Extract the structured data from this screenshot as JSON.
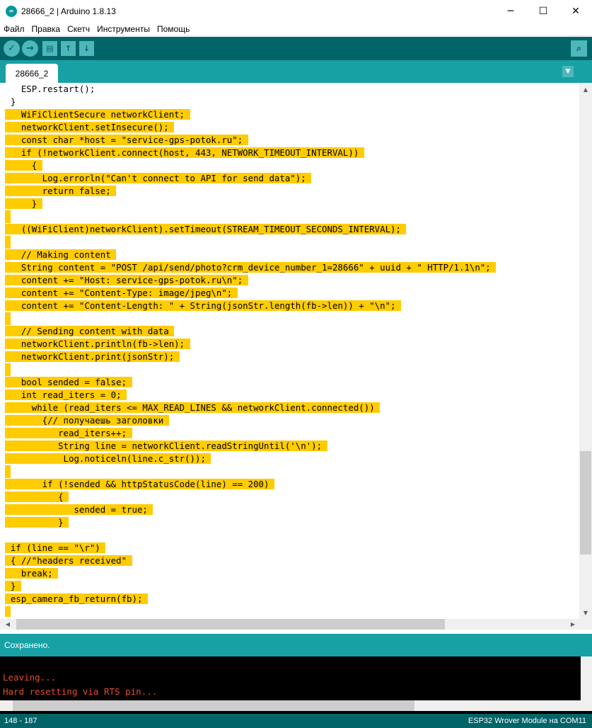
{
  "window": {
    "title": "28666_2 | Arduino 1.8.13",
    "minimize": "─",
    "maximize": "☐",
    "close": "✕"
  },
  "menu": [
    "Файл",
    "Правка",
    "Скетч",
    "Инструменты",
    "Помощь"
  ],
  "toolbar": {
    "verify_icon": "✓",
    "upload_icon": "→",
    "new_icon": "▤",
    "open_icon": "↑",
    "save_icon": "↓",
    "serial_icon": "⌕"
  },
  "tab": {
    "label": "28666_2",
    "menu_icon": "▼"
  },
  "code_lines": [
    {
      "t": "    ESP.restart();",
      "hl": false
    },
    {
      "t": "  }",
      "hl": false
    },
    {
      "t": "    WiFiClientSecure networkClient;",
      "hl": true
    },
    {
      "t": "    networkClient.setInsecure();",
      "hl": true
    },
    {
      "t": "    const char *host = \"service-gps-potok.ru\";",
      "hl": true
    },
    {
      "t": "    if (!networkClient.connect(host, 443, NETWORK_TIMEOUT_INTERVAL))",
      "hl": true
    },
    {
      "t": "      {",
      "hl": true
    },
    {
      "t": "        Log.errorln(\"Can't connect to API for send data\");",
      "hl": true
    },
    {
      "t": "        return false;",
      "hl": true
    },
    {
      "t": "      }",
      "hl": true
    },
    {
      "t": "",
      "hl": true
    },
    {
      "t": "    ((WiFiClient)networkClient).setTimeout(STREAM_TIMEOUT_SECONDS_INTERVAL);",
      "hl": true
    },
    {
      "t": "",
      "hl": true
    },
    {
      "t": "    // Making content",
      "hl": true
    },
    {
      "t": "    String content = \"POST /api/send/photo?crm_device_number_1=28666\" + uuid + \" HTTP/1.1\\n\";",
      "hl": true
    },
    {
      "t": "    content += \"Host: service-gps-potok.ru\\n\";",
      "hl": true
    },
    {
      "t": "    content += \"Content-Type: image/jpeg\\n\";",
      "hl": true
    },
    {
      "t": "    content += \"Content-Length: \" + String(jsonStr.length(fb->len)) + \"\\n\";",
      "hl": true
    },
    {
      "t": "",
      "hl": true
    },
    {
      "t": "    // Sending content with data",
      "hl": true
    },
    {
      "t": "    networkClient.println(fb->len);",
      "hl": true
    },
    {
      "t": "    networkClient.print(jsonStr);",
      "hl": true
    },
    {
      "t": "",
      "hl": true
    },
    {
      "t": "    bool sended = false;",
      "hl": true
    },
    {
      "t": "    int read_iters = 0;",
      "hl": true
    },
    {
      "t": "      while (read_iters <= MAX_READ_LINES && networkClient.connected())",
      "hl": true
    },
    {
      "t": "        {// получаешь заголовки",
      "hl": true
    },
    {
      "t": "           read_iters++;",
      "hl": true
    },
    {
      "t": "           String line = networkClient.readStringUntil('\\n');",
      "hl": true
    },
    {
      "t": "            Log.noticeln(line.c_str());",
      "hl": true
    },
    {
      "t": "",
      "hl": true
    },
    {
      "t": "        if (!sended && httpStatusCode(line) == 200)",
      "hl": true
    },
    {
      "t": "           {",
      "hl": true
    },
    {
      "t": "              sended = true;",
      "hl": true
    },
    {
      "t": "           }",
      "hl": true
    },
    {
      "t": "",
      "hl": false
    },
    {
      "t": "  if (line == \"\\r\")",
      "hl": true
    },
    {
      "t": "  { //\"headers received\"",
      "hl": true
    },
    {
      "t": "    break;",
      "hl": true
    },
    {
      "t": "  }",
      "hl": true
    },
    {
      "t": "  esp_camera_fb_return(fb);",
      "hl": true
    },
    {
      "t": "}",
      "hl": true
    }
  ],
  "status_message": "Сохранено.",
  "console": [
    "Leaving...",
    "Hard resetting via RTS pin..."
  ],
  "footer": {
    "line_info": "148 - 187",
    "board": "ESP32 Wrover Module на COM11"
  },
  "colors": {
    "highlight": "#ffcc00",
    "toolbar": "#006468",
    "tabbar": "#17a1a5",
    "keyword_orange": "#d35400",
    "keyword_teal": "#00979c",
    "console_text": "#e34c26"
  }
}
